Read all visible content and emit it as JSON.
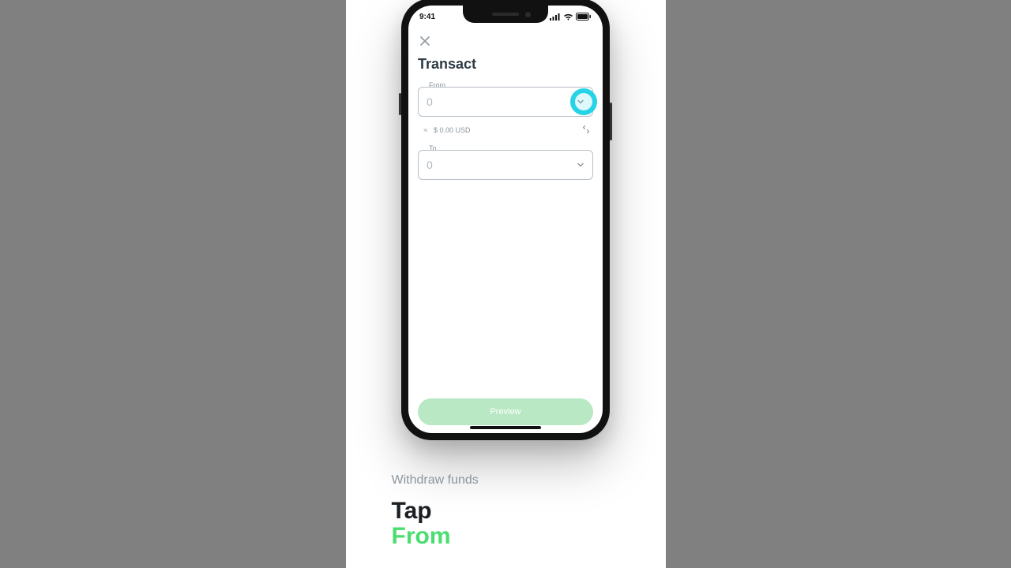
{
  "statusBar": {
    "time": "9:41"
  },
  "app": {
    "title": "Transact",
    "from": {
      "label": "From",
      "placeholder": "0"
    },
    "conversion": {
      "approx": "≈",
      "amount": "$ 0.00 USD"
    },
    "to": {
      "label": "To",
      "placeholder": "0"
    },
    "primaryButton": "Preview"
  },
  "instructions": {
    "subtitle": "Withdraw funds",
    "line1": "Tap",
    "line2": "From"
  }
}
